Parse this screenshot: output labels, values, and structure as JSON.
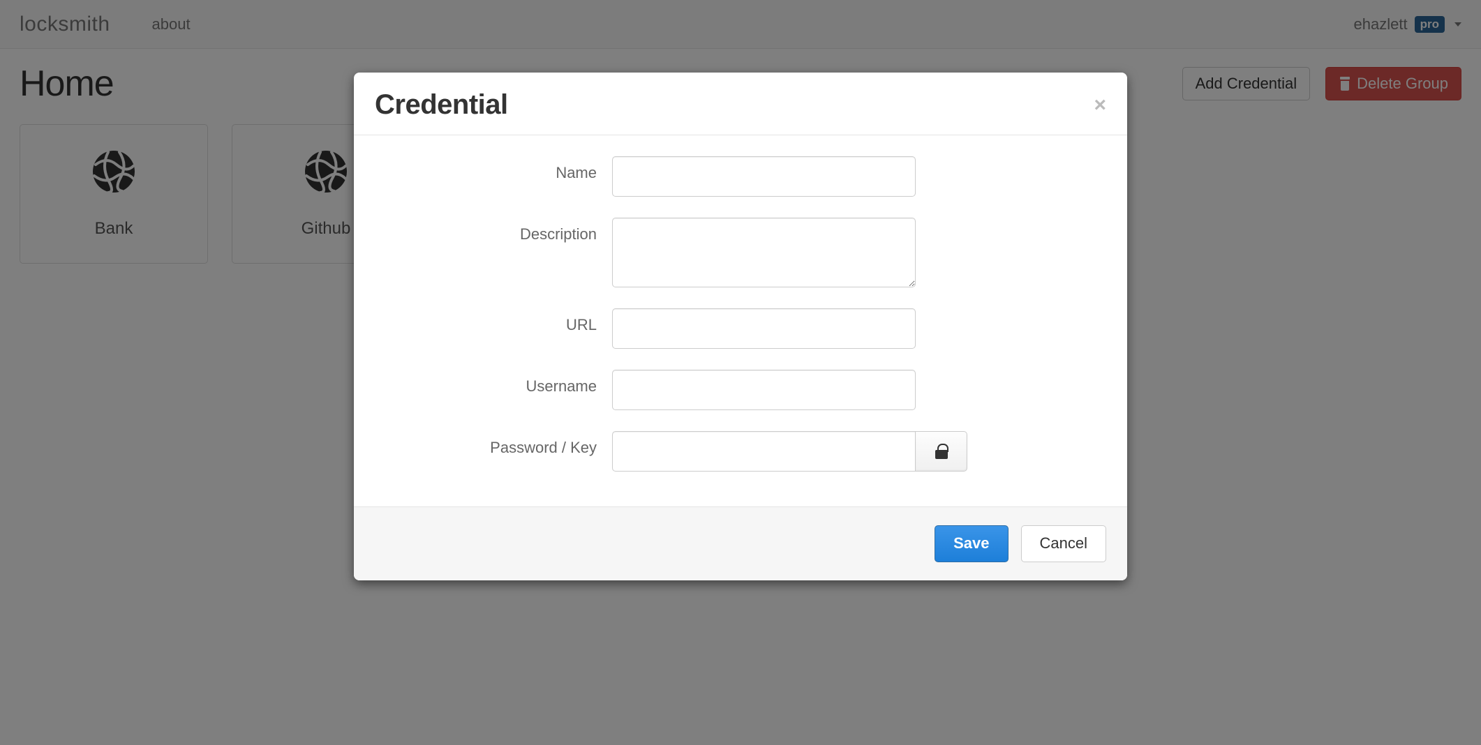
{
  "navbar": {
    "brand": "locksmith",
    "about": "about",
    "username": "ehazlett",
    "badge": "pro"
  },
  "page": {
    "title": "Home",
    "add_credential_label": "Add Credential",
    "delete_group_label": "Delete Group"
  },
  "cards": [
    {
      "label": "Bank"
    },
    {
      "label": "Github"
    }
  ],
  "modal": {
    "title": "Credential",
    "close_glyph": "×",
    "fields": {
      "name": {
        "label": "Name",
        "value": ""
      },
      "description": {
        "label": "Description",
        "value": ""
      },
      "url": {
        "label": "URL",
        "value": ""
      },
      "username": {
        "label": "Username",
        "value": ""
      },
      "password": {
        "label": "Password / Key",
        "value": ""
      }
    },
    "save_label": "Save",
    "cancel_label": "Cancel"
  }
}
